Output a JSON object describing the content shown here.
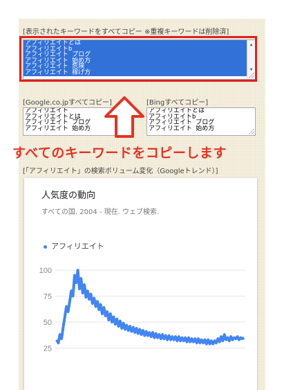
{
  "top_label": "[表示されたキーワードをすべてコピー ※重複キーワードは削除済]",
  "all_keywords_lines": [
    "アフィリエイトとは",
    "アフィリエイトb",
    "アフィリエイト ブログ",
    "アフィリエイト 始め方",
    "アフィリエイト 危険",
    "アフィリエイト 稼げ方"
  ],
  "google_label": "[Google.co.jpすべてコピー]",
  "google_lines": [
    "アフィリエイト",
    "アフィリエイトとは",
    "アフィリエイト ブログ",
    "アフィリエイト 始め方"
  ],
  "bing_label": "[Bingすべてコピー]",
  "bing_lines": [
    "アフィリエイトとは",
    "アフィリエイトb",
    "アフィリエイト ブログ",
    "アフィリエイト 始め方"
  ],
  "banner": "すべてのキーワードをコピーします",
  "trend_label": "[「アフィリエイト」の検索ボリューム変化（Googleトレンド）]",
  "card": {
    "title": "人気度の動向",
    "subtitle": "すべての国. 2004 - 現在. ウェブ検索.",
    "legend": "アフィリエイト"
  },
  "colors": {
    "accent_red": "#e02020",
    "banner_red": "#e53222",
    "series_blue": "#4285f4",
    "selection_blue": "#3271d8"
  },
  "chart_data": {
    "type": "line",
    "title": "人気度の動向",
    "xlabel": "",
    "ylabel": "",
    "ylim": [
      20,
      100
    ],
    "yticks": [
      100,
      75,
      50,
      25
    ],
    "grid": true,
    "series": [
      {
        "name": "アフィリエイト",
        "values": [
          33,
          30,
          38,
          34,
          45,
          55,
          65,
          60,
          70,
          80,
          75,
          95,
          88,
          100,
          82,
          92,
          78,
          86,
          74,
          80,
          72,
          77,
          68,
          73,
          65,
          70,
          62,
          67,
          58,
          64,
          56,
          60,
          52,
          58,
          50,
          55,
          48,
          53,
          46,
          51,
          44,
          49,
          43,
          47,
          42,
          46,
          41,
          45,
          40,
          44,
          39,
          43,
          38,
          42,
          37,
          41,
          37,
          40,
          36,
          40,
          35,
          39,
          35,
          38,
          34,
          38,
          34,
          37,
          33,
          37,
          33,
          36,
          33,
          36,
          32,
          36,
          32,
          35,
          32,
          35,
          31,
          35,
          31,
          34,
          31,
          34,
          30,
          34,
          30,
          33,
          30,
          33,
          29,
          33,
          29,
          32,
          29,
          32,
          30,
          34,
          31,
          36,
          32,
          38,
          33,
          35,
          32,
          36,
          33,
          35,
          34,
          36,
          33,
          35,
          34,
          35
        ]
      }
    ]
  }
}
